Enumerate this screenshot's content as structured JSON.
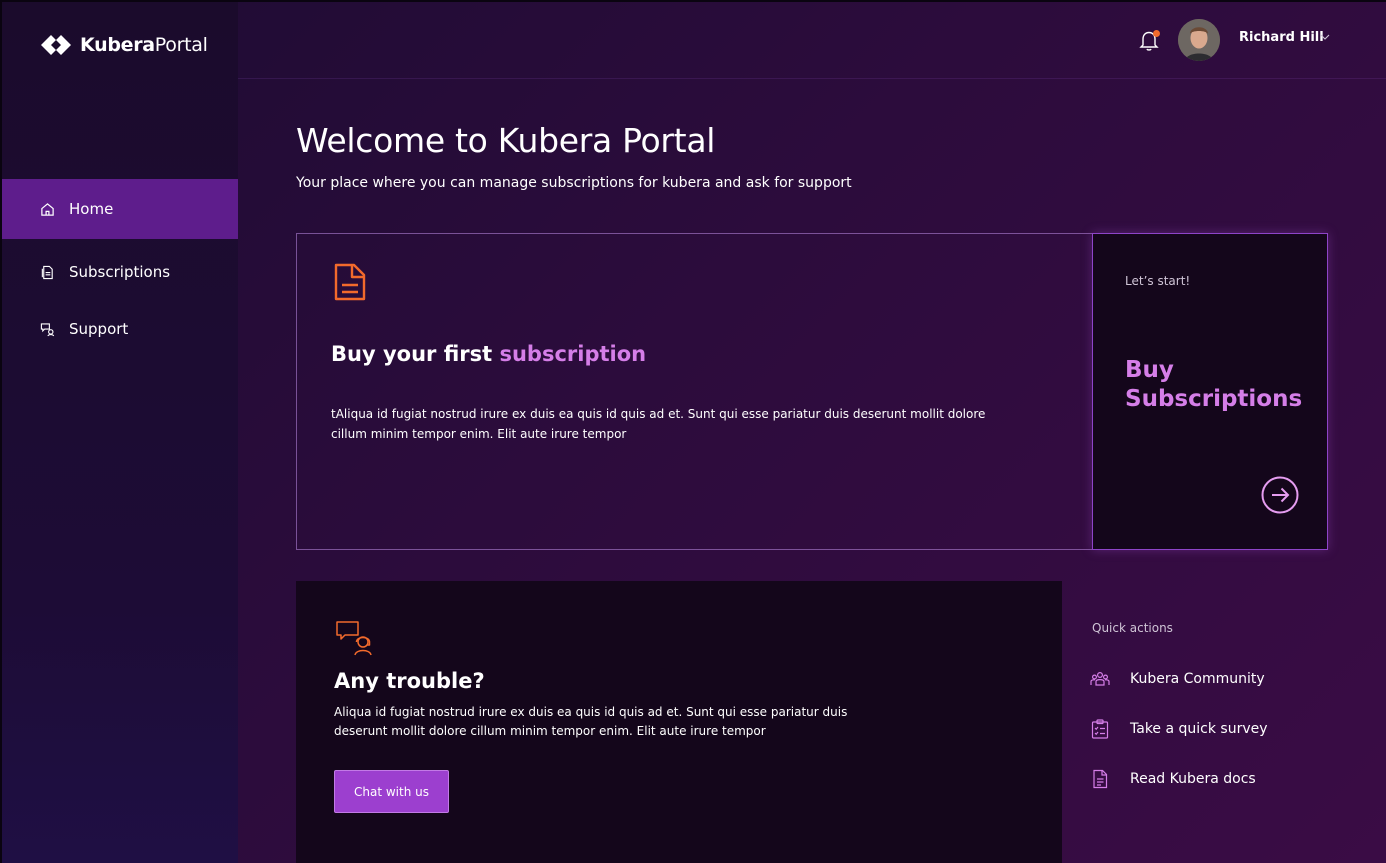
{
  "app": {
    "brand_bold": "Kubera",
    "brand_light": "Portal"
  },
  "sidebar": {
    "items": [
      {
        "label": "Home",
        "icon": "home-icon",
        "active": true
      },
      {
        "label": "Subscriptions",
        "icon": "document-icon",
        "active": false
      },
      {
        "label": "Support",
        "icon": "support-chat-icon",
        "active": false
      }
    ]
  },
  "header": {
    "user_name": "Richard Hill",
    "notification_badge_color": "#f26a2c"
  },
  "welcome": {
    "title": "Welcome to Kubera Portal",
    "subtitle": "Your place where you can manage subscriptions for kubera and ask for support"
  },
  "hero": {
    "title_prefix": "Buy your first ",
    "title_accent": "subscription",
    "body": "tAliqua id fugiat nostrud irure ex duis ea quis id quis ad et. Sunt qui esse pariatur duis deserunt mollit dolore cillum minim tempor enim. Elit aute irure tempor"
  },
  "buy_card": {
    "pre": "Let’s start!",
    "title": "Buy Subscriptions"
  },
  "trouble": {
    "title": "Any trouble?",
    "body": "Aliqua id fugiat nostrud irure ex duis ea quis id quis ad et. Sunt qui esse pariatur duis deserunt mollit dolore cillum minim tempor enim. Elit aute irure tempor",
    "button": "Chat with us"
  },
  "quick_actions": {
    "heading": "Quick actions",
    "items": [
      {
        "label": "Kubera Community",
        "icon": "community-icon"
      },
      {
        "label": "Take a quick survey",
        "icon": "survey-icon"
      },
      {
        "label": "Read Kubera docs",
        "icon": "docs-icon"
      }
    ]
  },
  "colors": {
    "accent": "#d57ee8",
    "active_nav": "#5e1d8c",
    "button": "#9c3fcf",
    "icon_orange": "#f26a2c"
  }
}
